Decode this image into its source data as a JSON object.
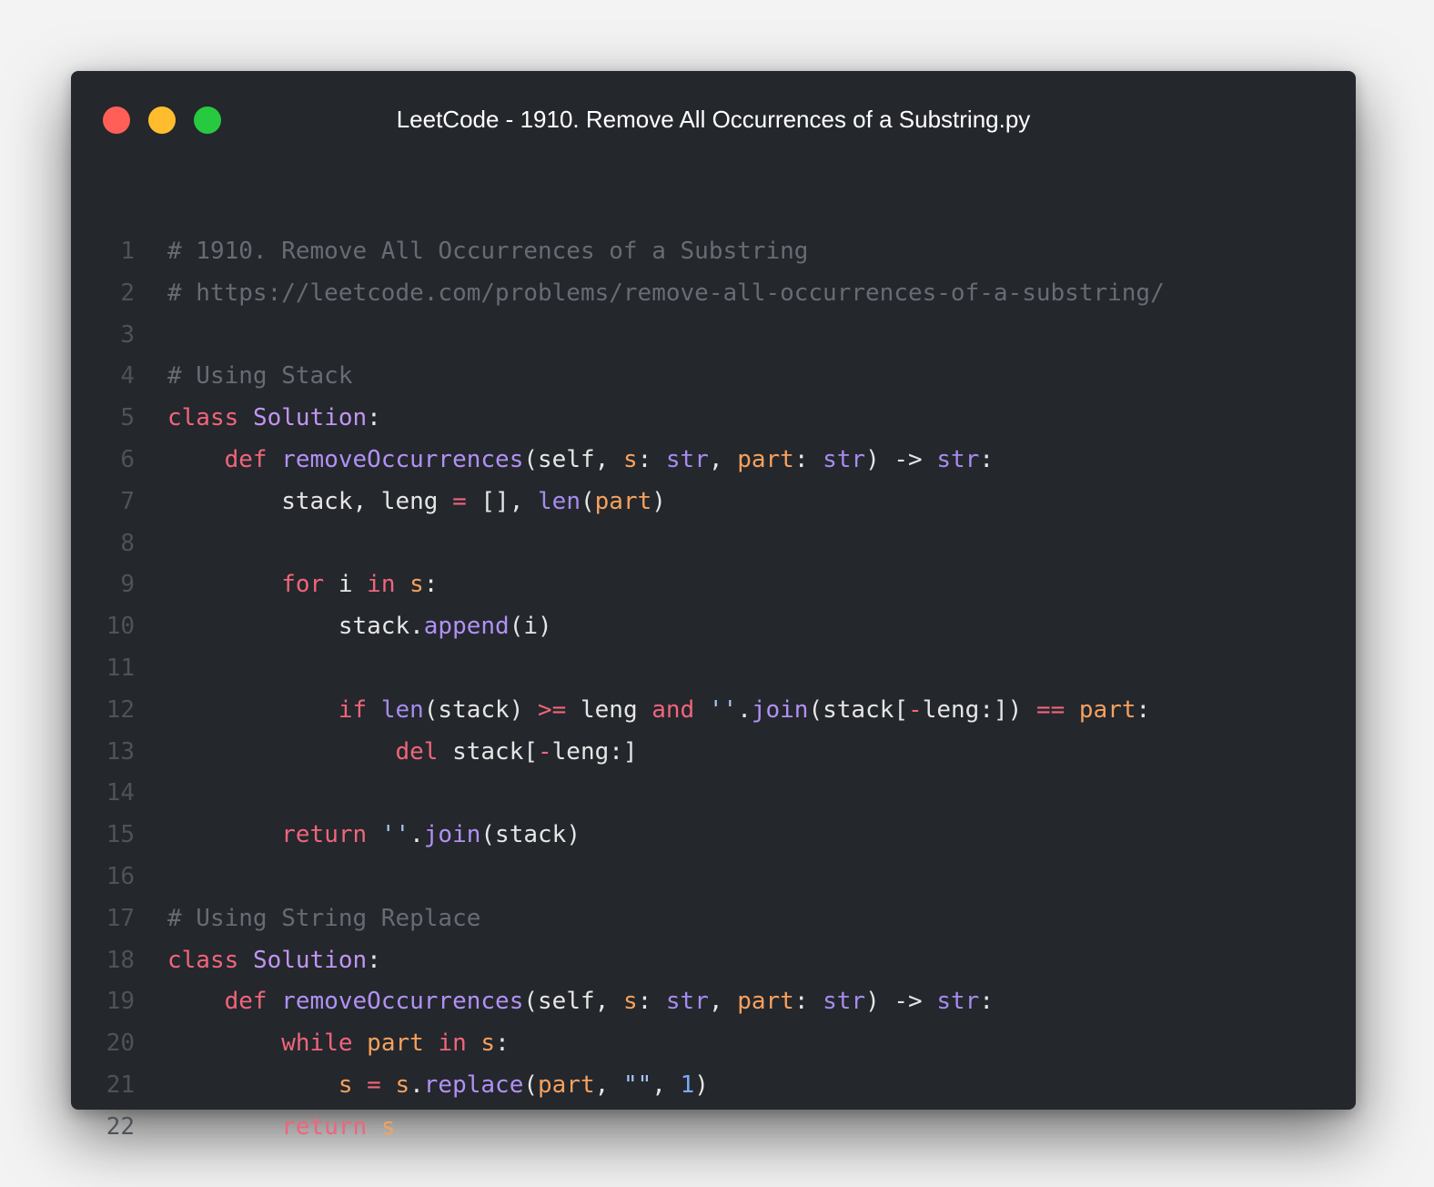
{
  "window": {
    "title": "LeetCode - 1910. Remove All Occurrences of a Substring.py",
    "buttons": [
      "close",
      "minimize",
      "maximize"
    ],
    "colors": {
      "background": "#24272c",
      "close": "#ff5f56",
      "minimize": "#ffbd2e",
      "maximize": "#27c93f"
    }
  },
  "code": {
    "language": "python",
    "lines": [
      {
        "number": "1",
        "tokens": [
          {
            "t": "comment",
            "v": "# 1910. Remove All Occurrences of a Substring"
          }
        ]
      },
      {
        "number": "2",
        "tokens": [
          {
            "t": "comment",
            "v": "# https://leetcode.com/problems/remove-all-occurrences-of-a-substring/"
          }
        ]
      },
      {
        "number": "3",
        "tokens": []
      },
      {
        "number": "4",
        "tokens": [
          {
            "t": "comment",
            "v": "# Using Stack"
          }
        ]
      },
      {
        "number": "5",
        "tokens": [
          {
            "t": "keyword",
            "v": "class"
          },
          {
            "t": "default",
            "v": " "
          },
          {
            "t": "class",
            "v": "Solution"
          },
          {
            "t": "default",
            "v": ":"
          }
        ]
      },
      {
        "number": "6",
        "tokens": [
          {
            "t": "default",
            "v": "    "
          },
          {
            "t": "keyword",
            "v": "def"
          },
          {
            "t": "default",
            "v": " "
          },
          {
            "t": "func",
            "v": "removeOccurrences"
          },
          {
            "t": "default",
            "v": "(self, "
          },
          {
            "t": "param",
            "v": "s"
          },
          {
            "t": "default",
            "v": ": "
          },
          {
            "t": "builtin",
            "v": "str"
          },
          {
            "t": "default",
            "v": ", "
          },
          {
            "t": "param",
            "v": "part"
          },
          {
            "t": "default",
            "v": ": "
          },
          {
            "t": "builtin",
            "v": "str"
          },
          {
            "t": "default",
            "v": ") -> "
          },
          {
            "t": "builtin",
            "v": "str"
          },
          {
            "t": "default",
            "v": ":"
          }
        ]
      },
      {
        "number": "7",
        "tokens": [
          {
            "t": "default",
            "v": "        stack, leng "
          },
          {
            "t": "operator",
            "v": "="
          },
          {
            "t": "default",
            "v": " [], "
          },
          {
            "t": "builtin",
            "v": "len"
          },
          {
            "t": "default",
            "v": "("
          },
          {
            "t": "param",
            "v": "part"
          },
          {
            "t": "default",
            "v": ")"
          }
        ]
      },
      {
        "number": "8",
        "tokens": []
      },
      {
        "number": "9",
        "tokens": [
          {
            "t": "default",
            "v": "        "
          },
          {
            "t": "keyword",
            "v": "for"
          },
          {
            "t": "default",
            "v": " i "
          },
          {
            "t": "keyword",
            "v": "in"
          },
          {
            "t": "default",
            "v": " "
          },
          {
            "t": "param",
            "v": "s"
          },
          {
            "t": "default",
            "v": ":"
          }
        ]
      },
      {
        "number": "10",
        "tokens": [
          {
            "t": "default",
            "v": "            stack."
          },
          {
            "t": "func",
            "v": "append"
          },
          {
            "t": "default",
            "v": "(i)"
          }
        ]
      },
      {
        "number": "11",
        "tokens": []
      },
      {
        "number": "12",
        "tokens": [
          {
            "t": "default",
            "v": "            "
          },
          {
            "t": "keyword",
            "v": "if"
          },
          {
            "t": "default",
            "v": " "
          },
          {
            "t": "builtin",
            "v": "len"
          },
          {
            "t": "default",
            "v": "(stack) "
          },
          {
            "t": "operator",
            "v": ">="
          },
          {
            "t": "default",
            "v": " leng "
          },
          {
            "t": "keyword",
            "v": "and"
          },
          {
            "t": "default",
            "v": " "
          },
          {
            "t": "string",
            "v": "''"
          },
          {
            "t": "default",
            "v": "."
          },
          {
            "t": "func",
            "v": "join"
          },
          {
            "t": "default",
            "v": "(stack["
          },
          {
            "t": "operator",
            "v": "-"
          },
          {
            "t": "default",
            "v": "leng:]) "
          },
          {
            "t": "operator",
            "v": "=="
          },
          {
            "t": "default",
            "v": " "
          },
          {
            "t": "param",
            "v": "part"
          },
          {
            "t": "default",
            "v": ":"
          }
        ]
      },
      {
        "number": "13",
        "tokens": [
          {
            "t": "default",
            "v": "                "
          },
          {
            "t": "keyword",
            "v": "del"
          },
          {
            "t": "default",
            "v": " stack["
          },
          {
            "t": "operator",
            "v": "-"
          },
          {
            "t": "default",
            "v": "leng:]"
          }
        ]
      },
      {
        "number": "14",
        "tokens": []
      },
      {
        "number": "15",
        "tokens": [
          {
            "t": "default",
            "v": "        "
          },
          {
            "t": "keyword",
            "v": "return"
          },
          {
            "t": "default",
            "v": " "
          },
          {
            "t": "string",
            "v": "''"
          },
          {
            "t": "default",
            "v": "."
          },
          {
            "t": "func",
            "v": "join"
          },
          {
            "t": "default",
            "v": "(stack)"
          }
        ]
      },
      {
        "number": "16",
        "tokens": []
      },
      {
        "number": "17",
        "tokens": [
          {
            "t": "comment",
            "v": "# Using String Replace"
          }
        ]
      },
      {
        "number": "18",
        "tokens": [
          {
            "t": "keyword",
            "v": "class"
          },
          {
            "t": "default",
            "v": " "
          },
          {
            "t": "class",
            "v": "Solution"
          },
          {
            "t": "default",
            "v": ":"
          }
        ]
      },
      {
        "number": "19",
        "tokens": [
          {
            "t": "default",
            "v": "    "
          },
          {
            "t": "keyword",
            "v": "def"
          },
          {
            "t": "default",
            "v": " "
          },
          {
            "t": "func",
            "v": "removeOccurrences"
          },
          {
            "t": "default",
            "v": "(self, "
          },
          {
            "t": "param",
            "v": "s"
          },
          {
            "t": "default",
            "v": ": "
          },
          {
            "t": "builtin",
            "v": "str"
          },
          {
            "t": "default",
            "v": ", "
          },
          {
            "t": "param",
            "v": "part"
          },
          {
            "t": "default",
            "v": ": "
          },
          {
            "t": "builtin",
            "v": "str"
          },
          {
            "t": "default",
            "v": ") -> "
          },
          {
            "t": "builtin",
            "v": "str"
          },
          {
            "t": "default",
            "v": ":"
          }
        ]
      },
      {
        "number": "20",
        "tokens": [
          {
            "t": "default",
            "v": "        "
          },
          {
            "t": "keyword",
            "v": "while"
          },
          {
            "t": "default",
            "v": " "
          },
          {
            "t": "param",
            "v": "part"
          },
          {
            "t": "default",
            "v": " "
          },
          {
            "t": "keyword",
            "v": "in"
          },
          {
            "t": "default",
            "v": " "
          },
          {
            "t": "param",
            "v": "s"
          },
          {
            "t": "default",
            "v": ":"
          }
        ]
      },
      {
        "number": "21",
        "tokens": [
          {
            "t": "default",
            "v": "            "
          },
          {
            "t": "param",
            "v": "s"
          },
          {
            "t": "default",
            "v": " "
          },
          {
            "t": "operator",
            "v": "="
          },
          {
            "t": "default",
            "v": " "
          },
          {
            "t": "param",
            "v": "s"
          },
          {
            "t": "default",
            "v": "."
          },
          {
            "t": "func",
            "v": "replace"
          },
          {
            "t": "default",
            "v": "("
          },
          {
            "t": "param",
            "v": "part"
          },
          {
            "t": "default",
            "v": ", "
          },
          {
            "t": "string",
            "v": "\"\""
          },
          {
            "t": "default",
            "v": ", "
          },
          {
            "t": "number",
            "v": "1"
          },
          {
            "t": "default",
            "v": ")"
          }
        ]
      },
      {
        "number": "22",
        "tokens": [
          {
            "t": "default",
            "v": "        "
          },
          {
            "t": "keyword",
            "v": "return"
          },
          {
            "t": "default",
            "v": " "
          },
          {
            "t": "param",
            "v": "s"
          }
        ]
      }
    ]
  }
}
